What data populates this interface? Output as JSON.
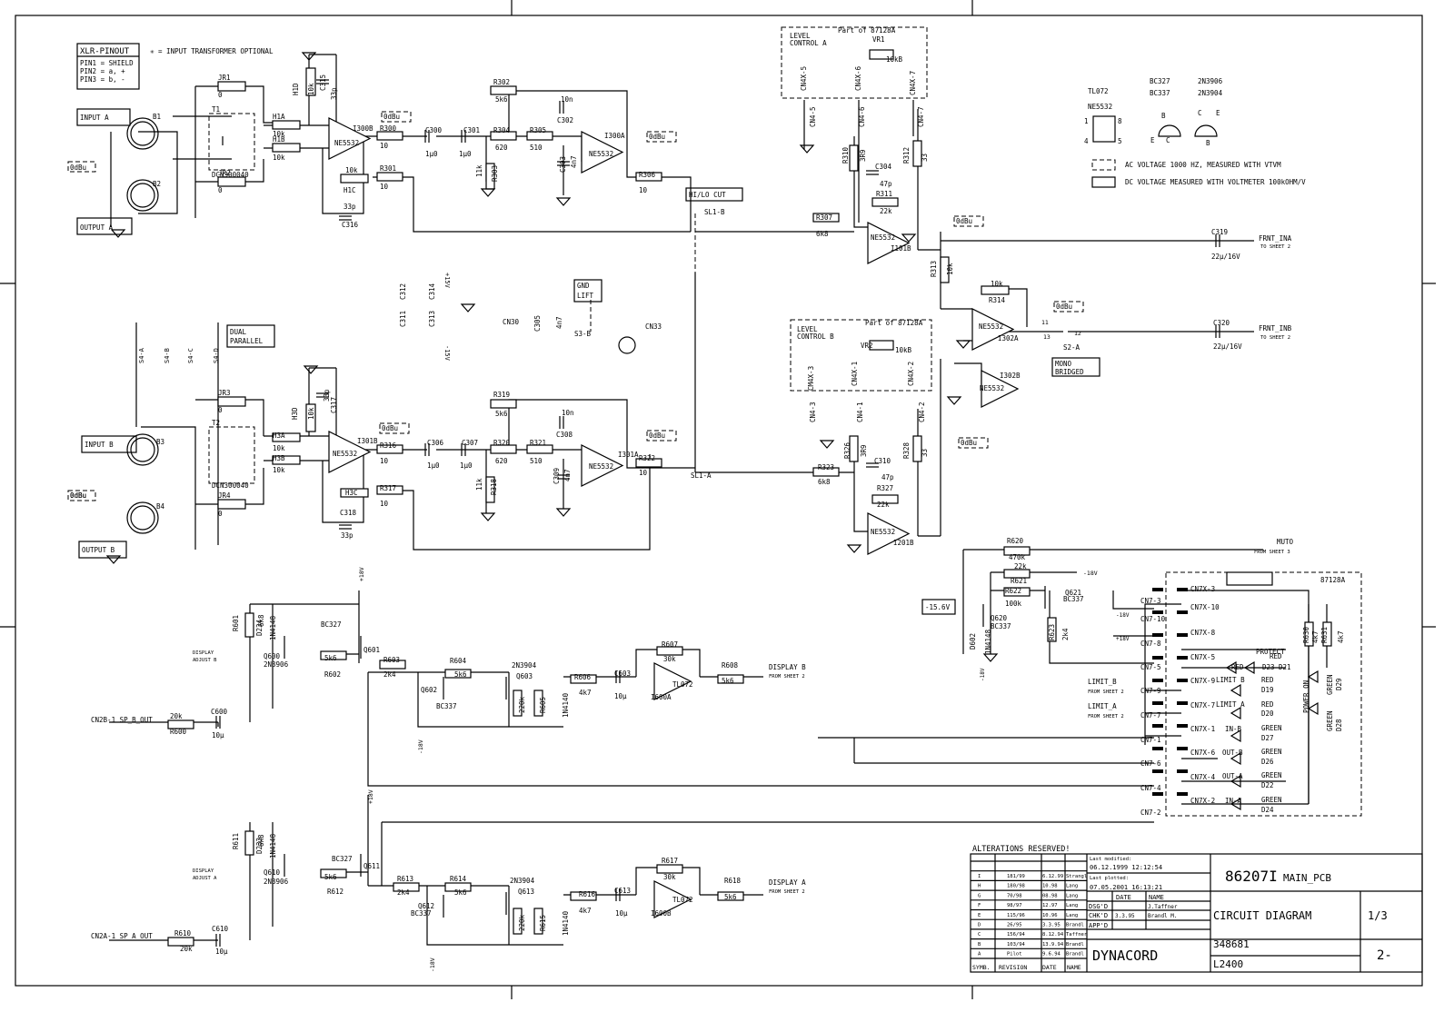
{
  "title_block": {
    "alterations": "ALTERATIONS RESERVED!",
    "last_modified_label": "Last modified:",
    "last_modified": "06.12.1999 12:12:54",
    "last_plotted_label": "Last plotted:",
    "last_plotted": "07.05.2001 16:13:21",
    "drawing_no": "86207I",
    "pcb": "MAIN_PCB",
    "title": "CIRCUIT DIAGRAM",
    "sheet": "1/3",
    "doc_no": "348681",
    "model": "L2400",
    "rev": "2-",
    "company": "DYNACORD",
    "date_h": "DATE",
    "name_h": "NAME",
    "dsgd": "DSG'D",
    "dsgd_name": "J.Taffner",
    "chkd": "CHK'D",
    "chkd_date": "3.3.95",
    "chkd_name": "Brandl M.",
    "appd": "APP'D",
    "col_symb": "SYMB.",
    "col_rev": "REVISION",
    "col_date": "DATE",
    "col_name": "NAME",
    "revisions": [
      [
        "I",
        "181/99",
        "6.12.99",
        "Strangl"
      ],
      [
        "H",
        "180/98",
        "10.98",
        "Lang"
      ],
      [
        "G",
        "70/98",
        "08.98",
        "Lang"
      ],
      [
        "F",
        "98/97",
        "12.97",
        "Lang"
      ],
      [
        "E",
        "115/96",
        "10.96",
        "Lang"
      ],
      [
        "D",
        "26/95",
        "3.3.95",
        "Brandl"
      ],
      [
        "C",
        "156/94",
        "8.12.94",
        "Taffner"
      ],
      [
        "B",
        "103/94",
        "13.9.94",
        "Brandl"
      ],
      [
        "A",
        "Pilot",
        "9.6.94",
        "Brandl"
      ]
    ]
  },
  "legend": {
    "ic1": "TL072",
    "ic2": "NE5532",
    "t1a": "BC327",
    "t1b": "BC337",
    "t2a": "2N3906",
    "t2b": "2N3904",
    "p1": "1",
    "p8": "8",
    "p4": "4",
    "p5": "5",
    "b1": "B",
    "e1": "E",
    "c1": "C",
    "c2": "C",
    "e2": "E",
    "b2": "B",
    "ac": "AC VOLTAGE 1000 HZ, MEASURED WITH VTVM",
    "dc": "DC VOLTAGE MEASURED WITH VOLTMETER 100kOHM/V"
  },
  "labels": {
    "xlr": "XLR-PINOUT",
    "pin1": "PIN1 = SHIELD",
    "pin2": "PIN2 = a, +",
    "pin3": "PIN3 = b, -",
    "opt": "✳ = INPUT TRANSFORMER OPTIONAL",
    "inA": "INPUT A",
    "outA": "OUTPUT A",
    "inB": "INPUT B",
    "outB": "OUTPUT B",
    "B1": "B1",
    "B2": "B2",
    "B3": "B3",
    "B4": "B4",
    "dbu1": "0dBu",
    "dbu2": "0dBu",
    "dbu3": "0dBu",
    "dbu4": "0dBu",
    "dbu5": "0dBu",
    "dbu6": "0dBu",
    "dbu7": "0dBu",
    "dbu8": "0dBu",
    "dbu9": "0dBu",
    "dbu10": "0dBu",
    "JR1": "JR1",
    "JR1v": "0",
    "JR2": "JR2",
    "JR2v": "0",
    "JR3": "JR3",
    "JR3v": "0",
    "JR4": "JR4",
    "JR4v": "0",
    "T1": "T1",
    "T2": "T2",
    "dcn1": "DCN300040",
    "dcn2": "DCN300040",
    "H1A": "H1A",
    "H1Av": "10k",
    "H1B": "H1B",
    "H1Bv": "10k",
    "H1D": "H1D",
    "H1Dv": "10k",
    "H1C": "H1C",
    "H1Cv": "10k",
    "C315": "C315",
    "C315v": "33p",
    "C316": "C316",
    "C316v": "33p",
    "I300B": "I300B",
    "ne1": "NE5532",
    "R300": "R300",
    "R300v": "10",
    "R301": "R301",
    "R301v": "10",
    "C300": "C300",
    "C300v": "1µ0",
    "C301": "C301",
    "C301v": "1µ0",
    "R304": "R304",
    "R304v": "620",
    "R303": "R303",
    "R303v": "11k",
    "R302": "R302",
    "R302v": "5k6",
    "R305": "R305",
    "R305v": "510",
    "C302": "C302",
    "C302v": "10n",
    "C303": "C303",
    "C303v": "4n7",
    "I300A": "I300A",
    "ne2": "NE5532",
    "R306": "R306",
    "R306v": "10",
    "hilo": "HI/LO CUT",
    "SL1B": "SL1-B",
    "SL1A": "SL1-A",
    "lcA": "LEVEL",
    "lcA2": "CONTROL A",
    "partA": "Part of 87128A",
    "VR1": "VR1",
    "VR1v": "10kB",
    "cnx5": "CN4X-5",
    "cnx6": "CN4X-6",
    "cnx7": "CN4X-7",
    "cn5": "CN4-5",
    "cn6": "CN4-6",
    "cn7": "CN4-7",
    "R310": "R310",
    "R310v": "3R9",
    "R312": "R312",
    "R312v": "33",
    "C304": "C304",
    "C304v": "47p",
    "R311": "R311",
    "R311v": "22k",
    "R307": "R307",
    "R307v": "6k8",
    "ne3": "NE5532",
    "I101B": "I101B",
    "C319": "C319",
    "C319v": "22µ/16V",
    "frntA": "FRNT_INA",
    "ts1": "TO SHEET 2",
    "R313": "R313",
    "R313v": "10k",
    "R314v": "10k",
    "R314": "R314",
    "ne4": "NE5532",
    "I302A": "I302A",
    "S2A": "S2-A",
    "p12": "12",
    "p13": "13",
    "p11": "11",
    "C320": "C320",
    "C320v": "22µ/16V",
    "frntB": "FRNT_INB",
    "ts2": "TO SHEET 2",
    "mono": "MONO",
    "bridged": "BRIDGED",
    "I302B": "I302B",
    "ne5": "NE5532",
    "gnd1": "GND",
    "gnd2": "LIFT",
    "C305": "C305",
    "C305v": "4n7",
    "S3B": "S3-B",
    "CN30": "CN30",
    "CN33": "CN33",
    "C311": "C311",
    "C312": "C312",
    "C313": "C313",
    "C314": "C314",
    "p15": "+15V",
    "m15": "-15V",
    "dual": "DUAL",
    "parallel": "PARALLEL",
    "S4A": "S4-A",
    "S4B": "S4-B",
    "S4C": "S4-C",
    "S4D": "S4-D",
    "lcB": "LEVEL",
    "lcB2": "CONTROL B",
    "partB": "Part of 87128A",
    "VR2": "VR2",
    "VR2v": "10kB",
    "cbx3": "CM4X-3",
    "cbx4": "CN4X-1",
    "cbx2": "CN4X-2",
    "cb3": "CN4-3",
    "cb1": "CN4-1",
    "cb2": "CN4-2",
    "R326": "R326",
    "R326v": "3R9",
    "R328": "R328",
    "R328v": "33",
    "C310": "C310",
    "C310v": "47p",
    "R327": "R327",
    "R327v": "22k",
    "R323": "R323",
    "R323v": "6k8",
    "ne6": "NE5532",
    "I201B": "I201B",
    "H3A": "H3A",
    "H3Av": "10k",
    "H3B": "H3B",
    "H3Bv": "10k",
    "H3D": "H3D",
    "H3Dv": "10k",
    "C317": "C317",
    "C317v": "33p",
    "ne7": "NE5532",
    "I301B": "I301B",
    "R316": "R316",
    "R316v": "10",
    "R317": "R317",
    "R317v": "10",
    "H3C": "H3C",
    "C318": "C318",
    "C318v": "33p",
    "C306": "C306",
    "C306v": "1µ0",
    "C307": "C307",
    "C307v": "1µ0",
    "R320": "R320",
    "R320v": "620",
    "R319": "R319",
    "R319v": "5k6",
    "R318": "R318",
    "R318v": "11k",
    "R321": "R321",
    "R321v": "510",
    "C308": "C308",
    "C308v": "10n",
    "C309": "C309",
    "C309v": "4n7",
    "I301A": "I301A",
    "ne8": "NE5532",
    "R322": "R322",
    "R322v": "10",
    "R601": "R601",
    "R601v": "6k8",
    "D234": "D234",
    "D234v": "1N4148",
    "Q600": "Q600",
    "Q600v": "2N3906",
    "adjB": "DISPLAY",
    "adjB2": "ADJUST B",
    "bc1": "BC327",
    "Q601": "Q601",
    "R602v": "5k6",
    "R602": "R602",
    "R603": "R603",
    "R603v": "2k4",
    "R604": "R604",
    "R604v": "5k6",
    "q603t": "2N3904",
    "Q603": "Q603",
    "Q602": "Q602",
    "Q602v": "BC337",
    "R605v": "220k",
    "R605": "R605",
    "D601": "1N4140",
    "R606": "R606",
    "R606v": "4k7",
    "C603": "C603",
    "C603v": "10µ",
    "R607": "R607",
    "R607v": "30k",
    "tl1": "TL072",
    "I600A": "I600A",
    "R608": "R608",
    "R608v": "5k6",
    "dispB": "DISPLAY B",
    "fs1": "FROM SHEET 2",
    "spB": "CN2B-1  SP_B_OUT",
    "R600v": "20k",
    "R600": "R600",
    "C600": "C600",
    "C600v": "10µ",
    "R611": "R611",
    "R611v": "6k8",
    "D233": "D233",
    "D233v": "1N4148",
    "Q610": "Q610",
    "Q610v": "2N3906",
    "adjA": "DISPLAY",
    "adjA2": "ADJUST A",
    "bc2": "BC327",
    "Q611": "Q611",
    "R612v": "5k6",
    "R612": "R612",
    "R613": "R613",
    "R613v": "2k4",
    "R614": "R614",
    "R614v": "5k6",
    "q613t": "2N3904",
    "Q613": "Q613",
    "Q612": "Q612",
    "Q612v": "BC337",
    "R615v": "220k",
    "R615": "R615",
    "D611": "1N4140",
    "R616": "R616",
    "R616v": "4k7",
    "C613": "C613",
    "C613v": "10µ",
    "R617": "R617",
    "R617v": "30k",
    "tl2": "TL072",
    "I600B": "I600B",
    "R618": "R618",
    "R618v": "5k6",
    "dispA": "DISPLAY A",
    "fs2": "FROM SHEET 2",
    "spA": "CN2A-1  SP_A_OUT",
    "R610": "R610",
    "R610v": "20k",
    "C610": "C610",
    "C610v": "10µ",
    "p18a": "+18V",
    "p18b": "+18V",
    "m18a": "-18V",
    "m18b": "-18V",
    "R620": "R620",
    "R620v": "470k",
    "muto": "MUTO",
    "fs3": "FROM SHEET 3",
    "R621v": "22k",
    "R621": "R621",
    "R622": "R622",
    "R622v": "100k",
    "m18c": "-18V",
    "Q621": "Q621",
    "Q621v": "BC337",
    "v156": "-15.6V",
    "Q620": "Q620",
    "Q620v": "BC337",
    "D602": "D602",
    "D602v": "1N4148",
    "m18d": "-18V",
    "R623": "R623",
    "R623v": "2k4",
    "pcb87": "87128A",
    "m18e": "-18V",
    "p18c": "+18V",
    "limB": "LIMIT_B",
    "fs4": "FROM SHEET 2",
    "limA": "LIMIT_A",
    "fs5": "FROM SHEET 2",
    "c73": "CN7-3",
    "c710": "CN7-10",
    "c78": "CN7-8",
    "c75": "CN7-5",
    "c79": "CN7-9",
    "c77": "CN7-7",
    "c71": "CN7-1",
    "c76": "CN7-6",
    "c74": "CN7-4",
    "c72": "CN7-2",
    "x3": "CN7X-3",
    "x10": "CN7X-10",
    "x8": "CN7X-8",
    "x5": "CN7X-5",
    "x9": "CN7X-9",
    "x7": "CN7X-7",
    "x1": "CN7X-1",
    "x6": "CN7X-6",
    "x4": "CN7X-4",
    "x2": "CN7X-2",
    "protect": "PROTECT",
    "red1": "RED",
    "red2": "RED",
    "D23": "D23",
    "D21": "D21",
    "lb": "LIMIT B",
    "red3": "RED",
    "D19": "D19",
    "la": "LIMIT A",
    "red4": "RED",
    "D20": "D20",
    "inb": "IN-B",
    "g1": "GREEN",
    "D27": "D27",
    "outb": "OUT-B",
    "g2": "GREEN",
    "D26": "D26",
    "outa": "OUT-A",
    "g3": "GREEN",
    "D22": "D22",
    "ina": "IN-A",
    "g4": "GREEN",
    "D24": "D24",
    "R630": "R630",
    "R630v": "4k7",
    "R631": "R631",
    "R631v": "4k7",
    "pwr": "POWER ON",
    "g5": "GREEN",
    "D29": "D29",
    "g6": "GREEN",
    "D28": "D28"
  }
}
